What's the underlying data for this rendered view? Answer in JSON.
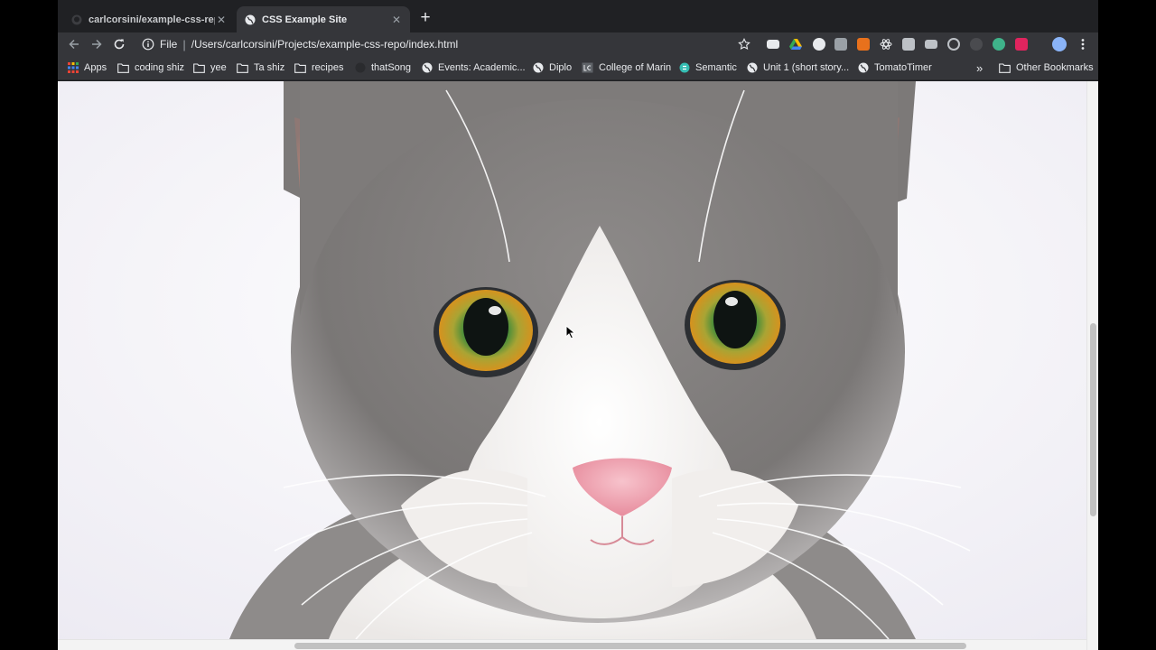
{
  "browser": {
    "tabs": [
      {
        "title": "carlcorsini/example-css-repo",
        "active": false,
        "icon": "github-icon"
      },
      {
        "title": "CSS Example Site",
        "active": true,
        "icon": "globe-icon"
      }
    ],
    "address": {
      "scheme_label": "File",
      "url": "/Users/carlcorsini/Projects/example-css-repo/index.html"
    },
    "bookmarks": [
      {
        "label": "Apps",
        "icon": "apps-grid-icon"
      },
      {
        "label": "coding shiz",
        "icon": "folder-icon"
      },
      {
        "label": "yee",
        "icon": "folder-icon"
      },
      {
        "label": "Ta shiz",
        "icon": "folder-icon"
      },
      {
        "label": "recipes",
        "icon": "folder-icon"
      },
      {
        "label": "thatSong",
        "icon": "site-icon"
      },
      {
        "label": "Events: Academic...",
        "icon": "globe-icon"
      },
      {
        "label": "Diplo",
        "icon": "globe-icon"
      },
      {
        "label": "College of Marin",
        "icon": "lg-icon"
      },
      {
        "label": "Semantic",
        "icon": "semantic-icon"
      },
      {
        "label": "Unit 1 (short story...",
        "icon": "globe-icon"
      },
      {
        "label": "TomatoTimer",
        "icon": "globe-icon"
      }
    ],
    "overflow_label": "»",
    "other_bookmarks": "Other Bookmarks"
  },
  "page": {
    "image_subject": "Gray and white cat with orange-green eyes facing camera"
  },
  "colors": {
    "chrome_dark": "#202124",
    "toolbar": "#35363a",
    "page_bg": "#f6f6fa",
    "cat_gray": "#7d7b7b",
    "cat_white": "#f4f2f0",
    "eye_amber": "#d79a2c",
    "eye_green": "#4b8e3a",
    "nose_pink": "#eba0ad"
  }
}
